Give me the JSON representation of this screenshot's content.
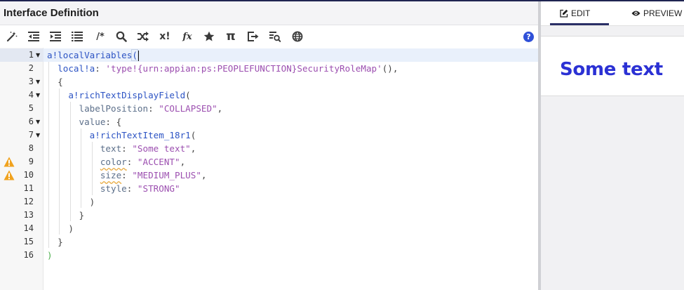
{
  "left_panel": {
    "title": "Interface Definition",
    "toolbar": [
      {
        "name": "magic-wand-icon"
      },
      {
        "name": "outdent-icon"
      },
      {
        "name": "indent-icon"
      },
      {
        "name": "align-lines-icon"
      },
      {
        "name": "comment-icon",
        "label": "/*"
      },
      {
        "name": "search-icon"
      },
      {
        "name": "shuffle-icon"
      },
      {
        "name": "expression-test-icon",
        "label": "x!"
      },
      {
        "name": "function-icon",
        "label": "fx"
      },
      {
        "name": "star-icon"
      },
      {
        "name": "pi-icon",
        "label": "π"
      },
      {
        "name": "export-icon"
      },
      {
        "name": "query-icon"
      },
      {
        "name": "globe-icon"
      }
    ],
    "help_label": "?"
  },
  "editor": {
    "line_numbers": [
      "1",
      "2",
      "3",
      "4",
      "5",
      "6",
      "7",
      "8",
      "9",
      "10",
      "11",
      "12",
      "13",
      "14",
      "15",
      "16"
    ],
    "code": {
      "l1_fn": "a!localVariables",
      "l1_paren": "(",
      "l2_key": "local!a",
      "l2_colon": ": ",
      "l2_str": "'type!{urn:appian:ps:PEOPLEFUNCTION}SecurityRoleMap'",
      "l2_end": "(),",
      "l3": "{",
      "l4_fn": "a!richTextDisplayField",
      "l4_paren": "(",
      "l5_key": "labelPosition",
      "l5_colon": ": ",
      "l5_str": "\"COLLAPSED\"",
      "l5_end": ",",
      "l6_key": "value",
      "l6_end": ": {",
      "l7_fn": "a!richTextItem_18r1",
      "l7_paren": "(",
      "l8_key": "text",
      "l8_colon": ": ",
      "l8_str": "\"Some text\"",
      "l8_end": ",",
      "l9_key": "color",
      "l9_colon": ": ",
      "l9_str": "\"ACCENT\"",
      "l9_end": ",",
      "l10_key": "size",
      "l10_colon": ": ",
      "l10_str": "\"MEDIUM_PLUS\"",
      "l10_end": ",",
      "l11_key": "style",
      "l11_colon": ": ",
      "l11_str": "\"STRONG\"",
      "l12": ")",
      "l13": "}",
      "l14": ")",
      "l15": "}",
      "l16": ")"
    },
    "colors": {
      "function": "#2d54c4",
      "key": "#5c6f8a",
      "string": "#9c4fb0",
      "warning": "#e8a83c"
    }
  },
  "right_panel": {
    "tabs": [
      {
        "label": "EDIT",
        "icon": "pencil-square-icon",
        "active": true
      },
      {
        "label": "PREVIEW",
        "icon": "eye-icon",
        "active": false
      }
    ],
    "preview_text": "Some text",
    "preview_color": "#2b31d4"
  }
}
